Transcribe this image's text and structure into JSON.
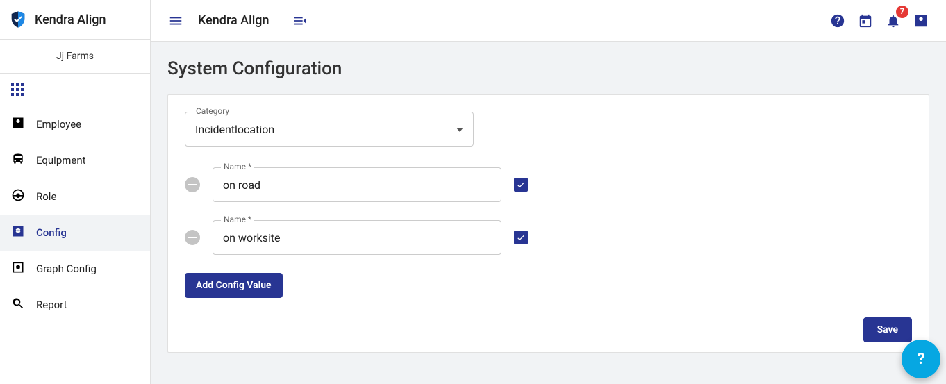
{
  "brand": {
    "name": "Kendra Align"
  },
  "org": {
    "name": "Jj Farms"
  },
  "sidebar": {
    "items": [
      {
        "label": "Employee",
        "icon": "person-box-icon",
        "active": false
      },
      {
        "label": "Equipment",
        "icon": "bus-icon",
        "active": false
      },
      {
        "label": "Role",
        "icon": "steering-icon",
        "active": false
      },
      {
        "label": "Config",
        "icon": "config-icon",
        "active": true
      },
      {
        "label": "Graph Config",
        "icon": "graph-config-icon",
        "active": false
      },
      {
        "label": "Report",
        "icon": "search-icon",
        "active": false
      }
    ]
  },
  "header": {
    "title": "Kendra Align",
    "notifications_count": "7"
  },
  "main": {
    "page_title": "System Configuration",
    "category_label": "Category",
    "category_value": "Incidentlocation",
    "name_label": "Name *",
    "rows": [
      {
        "value": "on road",
        "checked": true
      },
      {
        "value": "on worksite",
        "checked": true
      }
    ],
    "add_label": "Add Config Value",
    "save_label": "Save",
    "fab_label": "?"
  },
  "colors": {
    "primary": "#283593",
    "danger": "#e53935",
    "fab": "#06a7e2"
  }
}
